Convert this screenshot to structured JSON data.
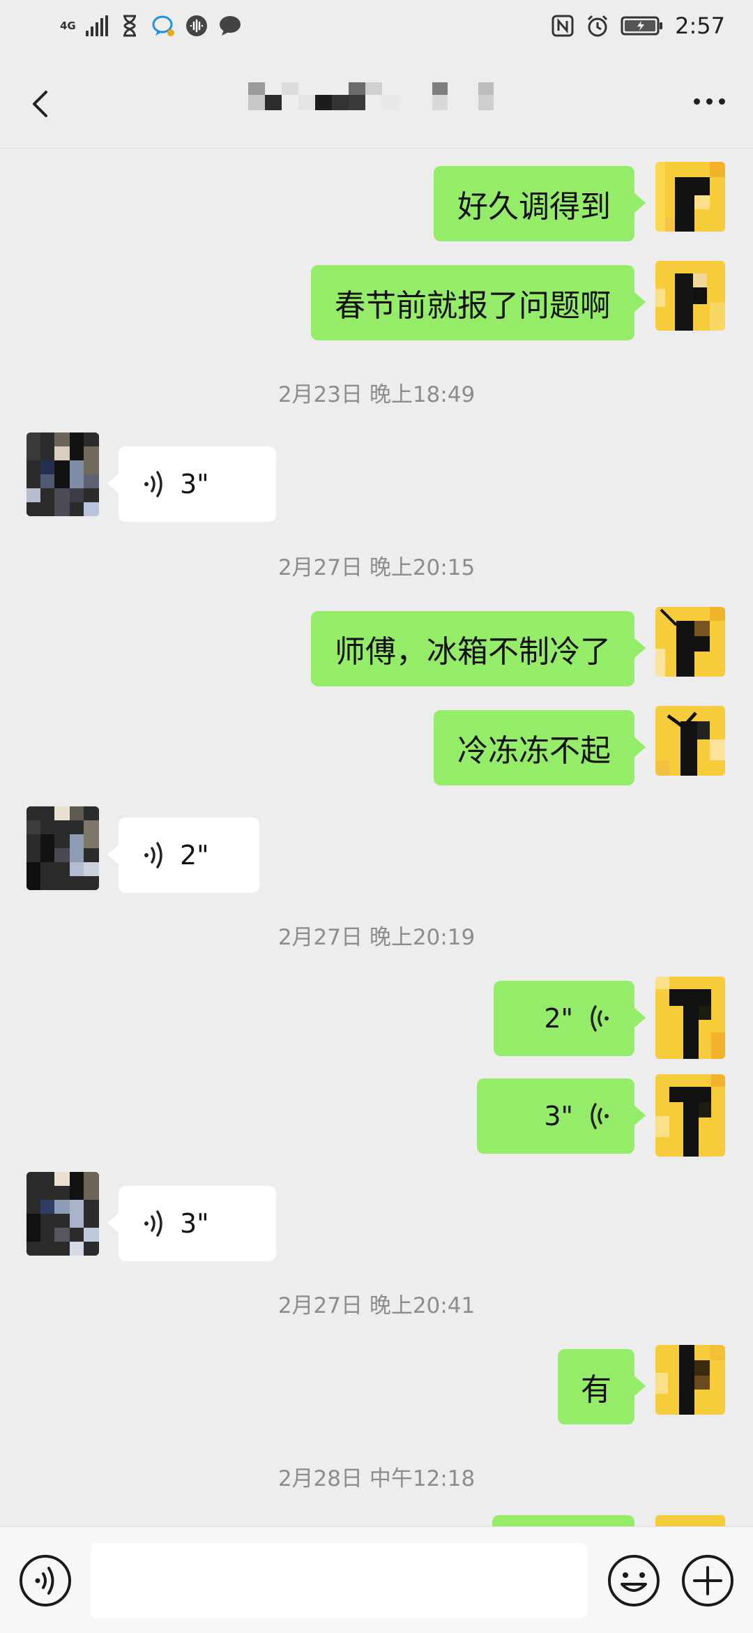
{
  "status_bar": {
    "network": "4G",
    "time": "2:57"
  },
  "header": {
    "back_icon": "chevron-left-icon",
    "title": "",
    "more_icon": "more-dots-icon"
  },
  "messages": [
    {
      "type": "text",
      "sender": "me",
      "text": "好久调得到"
    },
    {
      "type": "text",
      "sender": "me",
      "text": "春节前就报了问题啊"
    },
    {
      "type": "timestamp",
      "text": "2月23日 晚上18:49"
    },
    {
      "type": "voice",
      "sender": "other",
      "duration": "3\""
    },
    {
      "type": "timestamp",
      "text": "2月27日 晚上20:15"
    },
    {
      "type": "text",
      "sender": "me",
      "text": "师傅，冰箱不制冷了"
    },
    {
      "type": "text",
      "sender": "me",
      "text": "冷冻冻不起"
    },
    {
      "type": "voice",
      "sender": "other",
      "duration": "2\""
    },
    {
      "type": "timestamp",
      "text": "2月27日 晚上20:19"
    },
    {
      "type": "voice",
      "sender": "me",
      "duration": "2\""
    },
    {
      "type": "voice",
      "sender": "me",
      "duration": "3\""
    },
    {
      "type": "voice",
      "sender": "other",
      "duration": "3\""
    },
    {
      "type": "timestamp",
      "text": "2月27日 晚上20:41"
    },
    {
      "type": "text",
      "sender": "me",
      "text": "有"
    },
    {
      "type": "timestamp",
      "text": "2月28日 中午12:18"
    }
  ],
  "input_bar": {
    "voice_icon": "voice-mode-icon",
    "input_value": "",
    "emoji_icon": "emoji-icon",
    "plus_icon": "plus-circle-icon"
  },
  "colors": {
    "background": "#ededed",
    "my_bubble": "#95ec69",
    "other_bubble": "#ffffff",
    "timestamp_text": "#8c8c8c"
  }
}
